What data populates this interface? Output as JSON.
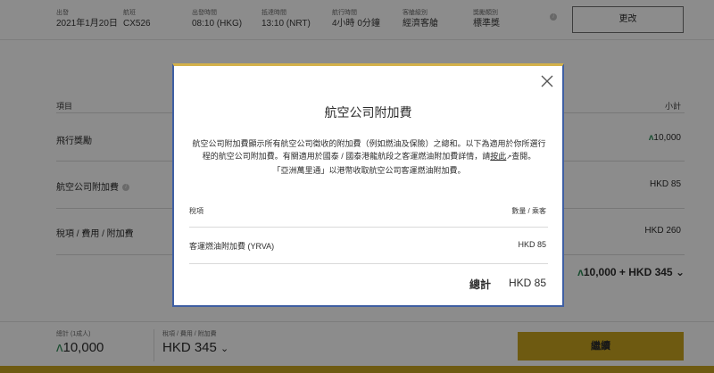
{
  "header": {
    "fields": [
      {
        "label": "出發",
        "value": "2021年1月20日"
      },
      {
        "label": "航班",
        "value": "CX526"
      },
      {
        "label": "出發時間",
        "value": "08:10 (HKG)"
      },
      {
        "label": "抵達時間",
        "value": "13:10 (NRT)"
      },
      {
        "label": "航行時間",
        "value": "4小時 0分鐘"
      },
      {
        "label": "客艙級別",
        "value": "經濟客艙"
      },
      {
        "label": "獎勵類別",
        "value": "標準獎"
      }
    ],
    "change_label": "更改"
  },
  "breakdown": {
    "col_item": "項目",
    "col_subtotal": "小計",
    "rows": [
      {
        "label": "飛行獎勵",
        "value": "10,000"
      },
      {
        "label": "航空公司附加費",
        "value": "HKD 85"
      },
      {
        "label": "稅項 / 費用 / 附加費",
        "value": "HKD 260"
      }
    ],
    "total": "10,000 + HKD 345"
  },
  "footer": {
    "total_label": "總計 (1成人)",
    "total_miles": "10,000",
    "tax_label": "稅項 / 費用 / 附加費",
    "tax_value": "HKD 345",
    "continue_label": "繼續"
  },
  "modal": {
    "title": "航空公司附加費",
    "body_part1": "航空公司附加費顯示所有航空公司徵收的附加費（例如燃油及保險）之總和。以下為適用於你所選行程的航空公司附加費。有關適用於國泰 / 國泰港龍航段之客運燃油附加費詳情，請",
    "link": "按此",
    "body_part2": "查閱。",
    "body_line2": "「亞洲萬里通」以港幣收取航空公司客運燃油附加費。",
    "col_tax": "稅項",
    "col_qty": "數量 / 乘客",
    "row_label": "客運燃油附加費 (YRVA)",
    "row_value": "HKD 85",
    "total_label": "總計",
    "total_value": "HKD 85"
  },
  "colors": {
    "accent": "#c9a51f",
    "modal_border": "#3f5fa3",
    "miles_symbol": "#2e8b57"
  }
}
